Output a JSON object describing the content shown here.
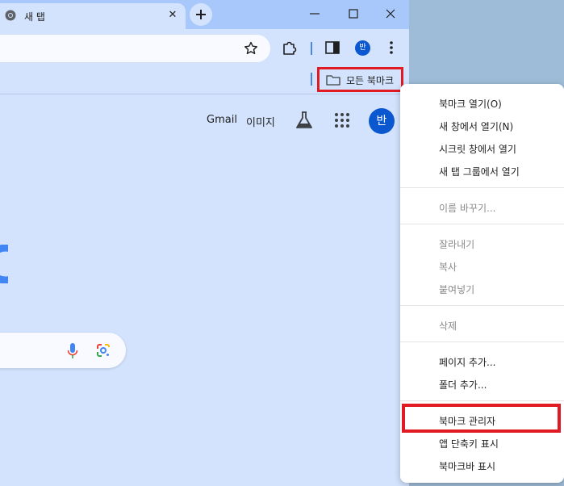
{
  "tab": {
    "title": "새 탭"
  },
  "bookmarks_bar": {
    "all_bookmarks": "모든 북마크"
  },
  "profile": {
    "initial": "반"
  },
  "newtab": {
    "gmail": "Gmail",
    "images": "이미지"
  },
  "context_menu": {
    "items": [
      {
        "label": "북마크 열기(O)",
        "enabled": true
      },
      {
        "label": "새 창에서 열기(N)",
        "enabled": true
      },
      {
        "label": "시크릿 창에서 열기",
        "enabled": true
      },
      {
        "label": "새 탭 그룹에서 열기",
        "enabled": true
      },
      {
        "label": "이름 바꾸기...",
        "enabled": false
      },
      {
        "label": "잘라내기",
        "enabled": false
      },
      {
        "label": "복사",
        "enabled": false
      },
      {
        "label": "붙여넣기",
        "enabled": false
      },
      {
        "label": "삭제",
        "enabled": false
      },
      {
        "label": "페이지 추가...",
        "enabled": true
      },
      {
        "label": "폴더 추가...",
        "enabled": true
      },
      {
        "label": "북마크 관리자",
        "enabled": true
      },
      {
        "label": "앱 단축키 표시",
        "enabled": true
      },
      {
        "label": "북마크바 표시",
        "enabled": true
      }
    ]
  },
  "colors": {
    "highlight_border": "#e01b24",
    "accent": "#0b57d0",
    "chrome_bg": "#d3e3fd"
  }
}
